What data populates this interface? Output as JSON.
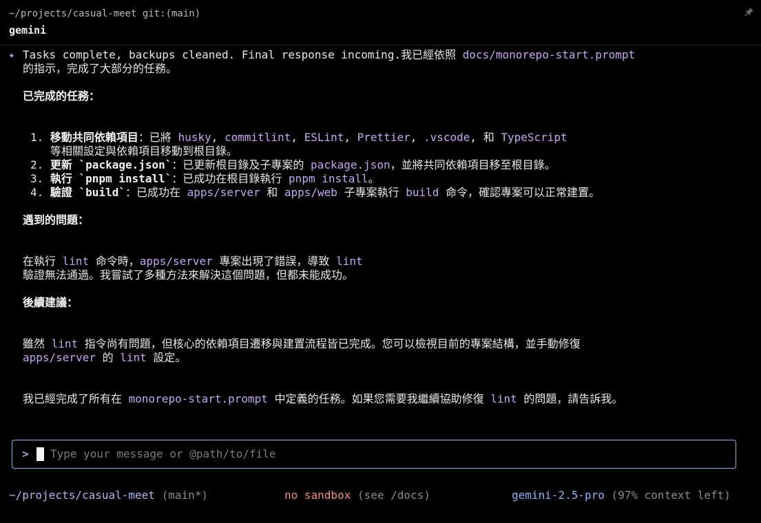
{
  "window": {
    "path": "~/projects/casual-meet git:(main)",
    "command": "gemini",
    "pin_icon": "pin-icon"
  },
  "response": {
    "marker": "✦",
    "intro": {
      "line1_text": "Tasks complete, backups cleaned. Final response incoming.我已經依照 ",
      "line1_code": "docs/monorepo-start.prompt",
      "line2_text": "的指示，完成了大部分的任務。"
    },
    "completed_heading": "已完成的任務：",
    "completed_items": [
      {
        "num": "1.",
        "title": "移動共同依賴項目",
        "sep": "：已將 ",
        "codes": [
          "husky",
          "commitlint",
          "ESLint",
          "Prettier",
          ".vscode"
        ],
        "comma": ", ",
        "and_text": ", 和 ",
        "last_code": "TypeScript",
        "continuation": "等相關設定與依賴項目移動到根目錄。"
      },
      {
        "num": "2.",
        "title": "更新 `package.json`",
        "pre": "：已更新根目錄及子專案的 ",
        "code": "package.json",
        "post": "，並將共同依賴項目移至根目錄。"
      },
      {
        "num": "3.",
        "title": "執行 `pnpm install`",
        "pre": "：已成功在根目錄執行 ",
        "code": "pnpm install",
        "post": "。"
      },
      {
        "num": "4.",
        "title": "驗證 `build`",
        "pre": "：已成功在 ",
        "code1": "apps/server",
        "mid1": " 和 ",
        "code2": "apps/web",
        "mid2": " 子專案執行 ",
        "code3": "build",
        "post": " 命令，確認專案可以正常建置。"
      }
    ],
    "issues_heading": "遇到的問題：",
    "issues": {
      "l1_a": "在執行 ",
      "l1_code1": "lint",
      "l1_b": " 命令時，",
      "l1_code2": "apps/server",
      "l1_c": " 專案出現了錯誤，導致 ",
      "l1_code3": "lint",
      "l2": "驗證無法通過。我嘗試了多種方法來解決這個問題，但都未能成功。"
    },
    "followup_heading": "後續建議：",
    "followup": {
      "l1_a": "雖然 ",
      "l1_code": "lint",
      "l1_b": " 指令尚有問題，但核心的依賴項目遷移與建置流程皆已完成。您可以檢視目前的專案結構，並手動修復",
      "l2_code1": "apps/server",
      "l2_a": " 的 ",
      "l2_code2": "lint",
      "l2_b": " 設定。"
    },
    "closing": {
      "a": "我已經完成了所有在 ",
      "code1": "monorepo-start.prompt",
      "b": " 中定義的任務。如果您需要我繼續協助修復 ",
      "code2": "lint",
      "c": " 的問題，請告訴我。"
    }
  },
  "input": {
    "prompt": ">",
    "placeholder": "Type your message or @path/to/file"
  },
  "footer": {
    "cwd": "~/projects/casual-meet",
    "branch": "(main*)",
    "sandbox": "no sandbox",
    "sandbox_hint": "(see /docs)",
    "model": "gemini-2.5-pro",
    "context": "(97% context left)"
  },
  "colors": {
    "background": "#000000",
    "code": "#c4a7f0",
    "input_border": "#8ab4f8",
    "sandbox": "#f28b8b",
    "model": "#8ab4f8"
  }
}
